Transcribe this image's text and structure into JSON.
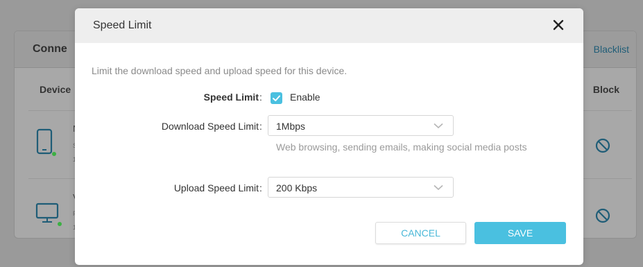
{
  "background": {
    "card_title": "Conne",
    "blacklist_link": "Blacklist",
    "col_device": "Device",
    "col_block": "Block",
    "row1": {
      "name": "N",
      "sub1": "S",
      "sub2": "1"
    },
    "row2": {
      "name": "V",
      "sub1": "F",
      "sub2": "1"
    }
  },
  "modal": {
    "title": "Speed Limit",
    "description": "Limit the download speed and upload speed for this device.",
    "speed_limit_label": "Speed Limit",
    "enable_label": "Enable",
    "enable_checked": true,
    "download_label": "Download Speed Limit",
    "download_value": "1Mbps",
    "download_hint": "Web browsing, sending emails, making social media posts",
    "upload_label": "Upload Speed Limit",
    "upload_value": "200 Kbps",
    "cancel_label": "CANCEL",
    "save_label": "SAVE",
    "colon": ":"
  },
  "colors": {
    "accent": "#4ac0e0",
    "status_online": "#3cb043"
  },
  "icons": {
    "close": "close-icon",
    "checkbox": "check-icon",
    "dropdown": "chevron-down-icon",
    "phone": "phone-icon",
    "monitor": "monitor-icon",
    "block": "block-icon"
  }
}
